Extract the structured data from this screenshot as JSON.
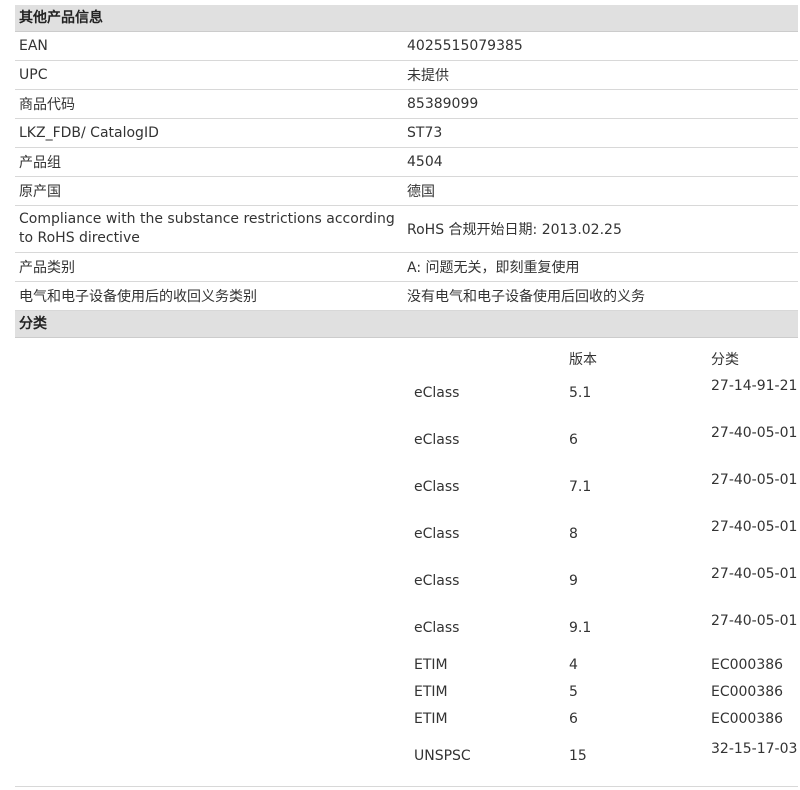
{
  "other_info": {
    "header": "其他产品信息",
    "rows": [
      {
        "label": "EAN",
        "value": "4025515079385"
      },
      {
        "label": "UPC",
        "value": "未提供"
      },
      {
        "label": "商品代码",
        "value": "85389099"
      },
      {
        "label": "LKZ_FDB/ CatalogID",
        "value": "ST73"
      },
      {
        "label": "产品组",
        "value": "4504"
      },
      {
        "label": "原产国",
        "value": "德国"
      },
      {
        "label": "Compliance with the substance restrictions according to RoHS directive",
        "value": "RoHS 合规开始日期: 2013.02.25"
      },
      {
        "label": "产品类别",
        "value": "A: 问题无关，即刻重复使用"
      },
      {
        "label": "电气和电子设备使用后的收回义务类别",
        "value": "没有电气和电子设备使用后回收的义务"
      }
    ]
  },
  "classification": {
    "header": "分类",
    "col_version": "版本",
    "col_class": "分类",
    "rows": [
      {
        "system": "eClass",
        "version": "5.1",
        "code": "27-14-91-21"
      },
      {
        "system": "eClass",
        "version": "6",
        "code": "27-40-05-01"
      },
      {
        "system": "eClass",
        "version": "7.1",
        "code": "27-40-05-01"
      },
      {
        "system": "eClass",
        "version": "8",
        "code": "27-40-05-01"
      },
      {
        "system": "eClass",
        "version": "9",
        "code": "27-40-05-01"
      },
      {
        "system": "eClass",
        "version": "9.1",
        "code": "27-40-05-01"
      },
      {
        "system": "ETIM",
        "version": "4",
        "code": "EC000386"
      },
      {
        "system": "ETIM",
        "version": "5",
        "code": "EC000386"
      },
      {
        "system": "ETIM",
        "version": "6",
        "code": "EC000386"
      },
      {
        "system": "UNSPSC",
        "version": "15",
        "code": "32-15-17-03"
      }
    ]
  }
}
